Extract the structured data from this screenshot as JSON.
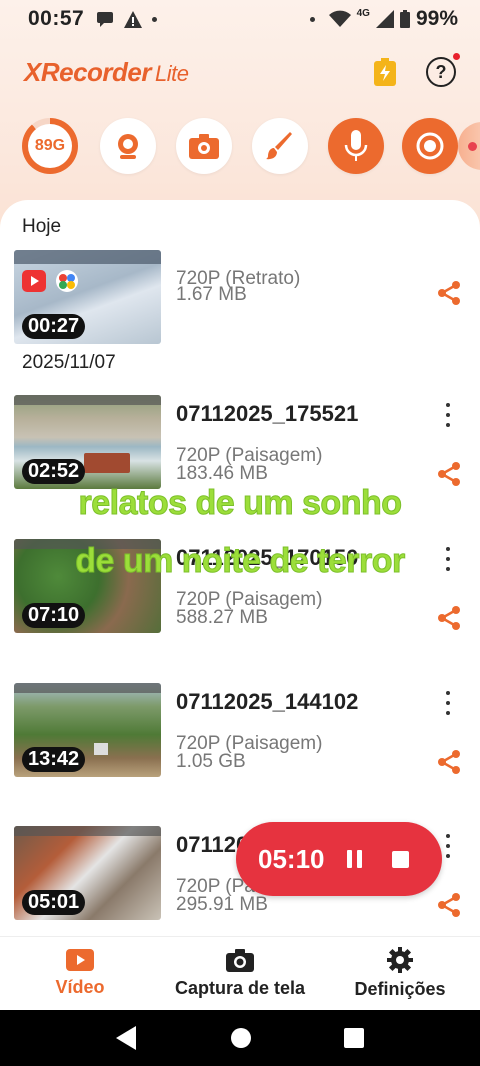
{
  "status_bar": {
    "time": "00:57",
    "network": "4G",
    "battery": "99%"
  },
  "app": {
    "logo": "XRecorder",
    "logo_suffix": "Lite"
  },
  "toolbar": {
    "storage": "89G",
    "icons": [
      "facecam-icon",
      "screenshot-icon",
      "brush-icon",
      "mic-icon",
      "record-icon"
    ]
  },
  "sections": [
    {
      "label": "Hoje"
    },
    {
      "label": "2025/11/07"
    }
  ],
  "videos": [
    {
      "name": "",
      "duration": "00:27",
      "resolution": "720P (Retrato)",
      "size": "1.67 MB"
    },
    {
      "name": "07112025_175521",
      "duration": "02:52",
      "resolution": "720P (Paisagem)",
      "size": "183.46 MB"
    },
    {
      "name": "07112025_170150",
      "duration": "07:10",
      "resolution": "720P (Paisagem)",
      "size": "588.27 MB"
    },
    {
      "name": "07112025_144102",
      "duration": "13:42",
      "resolution": "720P (Paisagem)",
      "size": "1.05 GB"
    },
    {
      "name": "07112025_1",
      "duration": "05:01",
      "resolution": "720P (Paisagem)",
      "size": "295.91 MB"
    }
  ],
  "overlay": {
    "line1": "relatos de um sonho",
    "line2": "de um noite de terror"
  },
  "recording": {
    "time": "05:10"
  },
  "bottom_nav": {
    "video": "Vídeo",
    "screenshot": "Captura de tela",
    "settings": "Definições"
  },
  "colors": {
    "accent": "#ec6a2e",
    "record": "#e6333f",
    "overlay_text": "#9cde3a"
  }
}
